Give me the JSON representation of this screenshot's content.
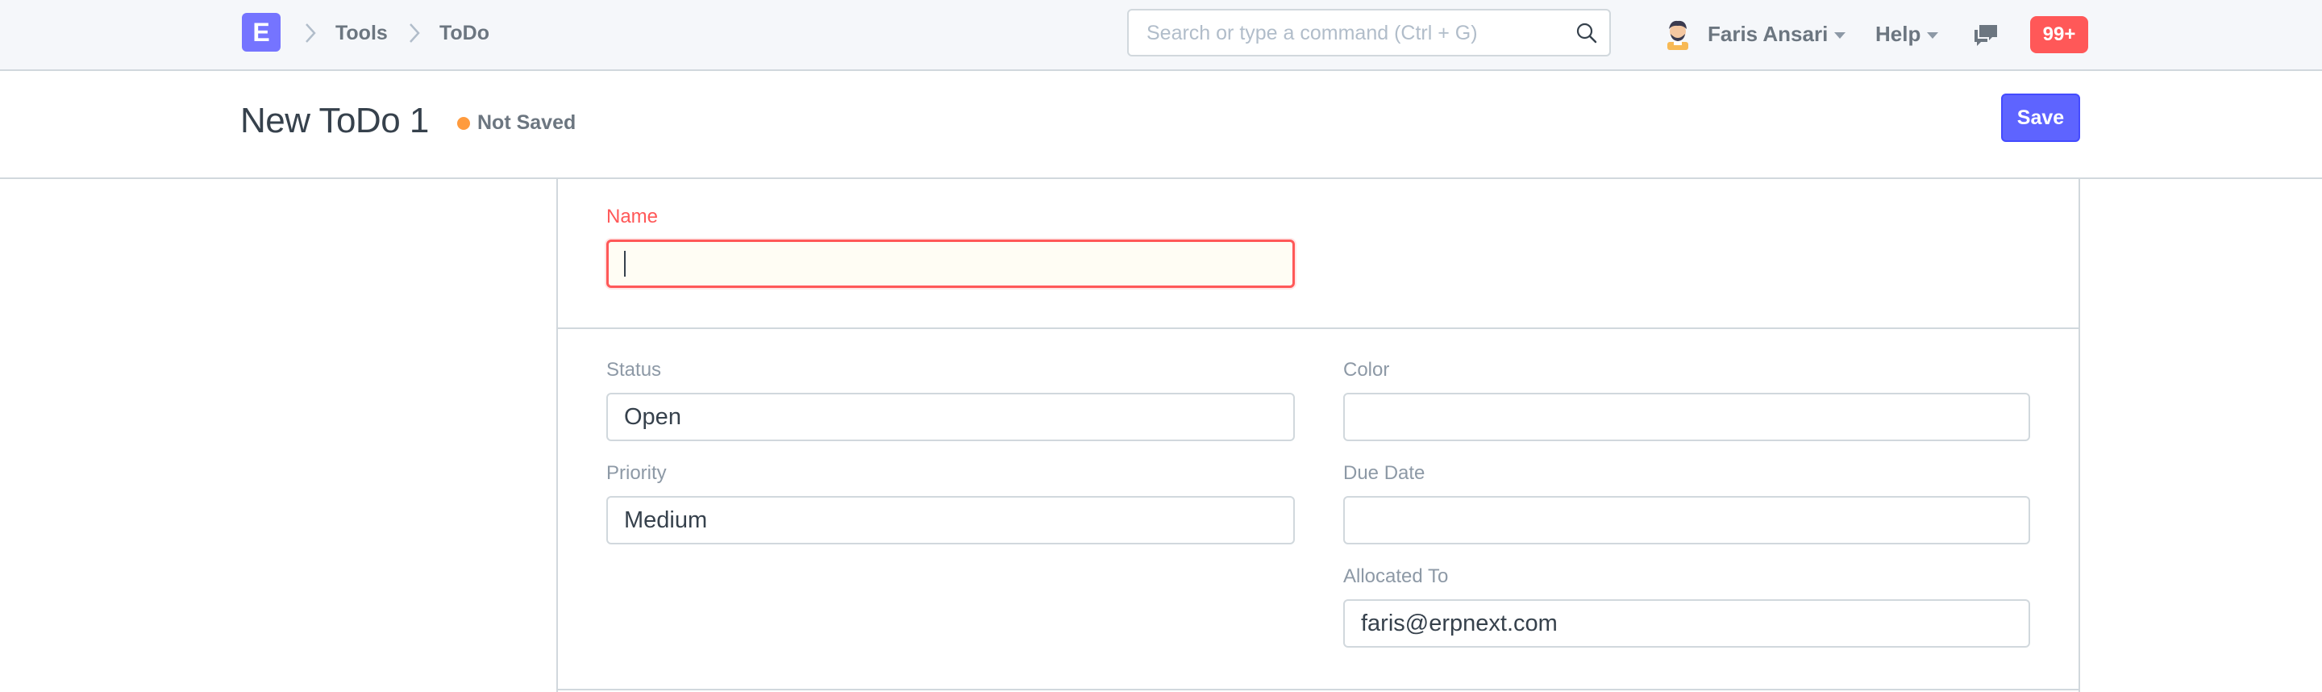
{
  "navbar": {
    "logo_letter": "E",
    "breadcrumbs": [
      "Tools",
      "ToDo"
    ],
    "search": {
      "placeholder": "Search or type a command (Ctrl + G)",
      "value": ""
    },
    "user_name": "Faris Ansari",
    "help_label": "Help",
    "notifications_count": "99+"
  },
  "page": {
    "title": "New ToDo 1",
    "indicator": "Not Saved",
    "save_label": "Save"
  },
  "form": {
    "name": {
      "label": "Name",
      "value": ""
    },
    "status": {
      "label": "Status",
      "value": "Open"
    },
    "priority": {
      "label": "Priority",
      "value": "Medium"
    },
    "color": {
      "label": "Color",
      "value": ""
    },
    "due_date": {
      "label": "Due Date",
      "value": ""
    },
    "allocated_to": {
      "label": "Allocated To",
      "value": "faris@erpnext.com"
    }
  },
  "colors": {
    "primary": "#5e64ff",
    "logo": "#7574ff",
    "required": "#ff5858",
    "indicator_orange": "#ff9b3e",
    "badge_red": "#ff5858"
  },
  "icons": [
    "search-icon",
    "chevron-right-icon",
    "caret-down-icon",
    "chat-icon",
    "avatar"
  ]
}
